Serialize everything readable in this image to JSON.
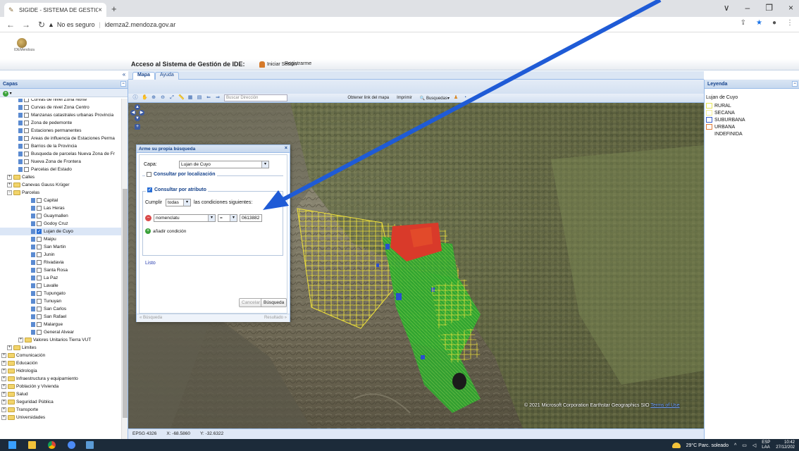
{
  "browser": {
    "tab_title": "SIGIDE - SISTEMA DE GESTION D",
    "tab_close": "×",
    "new_tab": "+",
    "security_warning": "No es seguro",
    "url": "idemza2.mendoza.gov.ar",
    "window_controls": [
      "∨",
      "–",
      "❐",
      "×"
    ]
  },
  "header": {
    "logo_text": "IDEMendoza",
    "access_title": "Acceso al Sistema de Gestión de IDE:",
    "login_label": "Iniciar Sesión",
    "register_label": "Registrarme"
  },
  "left_panel": {
    "title": "Capas",
    "collapse": "«",
    "tree": [
      {
        "label": "Curvas de nivel Zona Norte",
        "type": "layer",
        "checked": false,
        "indent": 2
      },
      {
        "label": "Curvas de nivel Zona Centro",
        "type": "layer",
        "checked": false,
        "indent": 2
      },
      {
        "label": "Manzanas catastrales urbanas Provincia",
        "type": "layer",
        "checked": false,
        "indent": 2
      },
      {
        "label": "Zona de pedemonte",
        "type": "layer",
        "checked": false,
        "indent": 2
      },
      {
        "label": "Estaciones permanentes",
        "type": "layer",
        "checked": false,
        "indent": 2
      },
      {
        "label": "Areas de influencia de Estaciones Perma",
        "type": "layer",
        "checked": false,
        "indent": 2
      },
      {
        "label": "Barrios de la Provincia",
        "type": "layer",
        "checked": false,
        "indent": 2
      },
      {
        "label": "Busqueda de parcelas Nueva Zona de Fr",
        "type": "layer",
        "checked": false,
        "indent": 2
      },
      {
        "label": "Nueva Zona de Frontera",
        "type": "layer",
        "checked": false,
        "indent": 2
      },
      {
        "label": "Parcelas del Estado",
        "type": "layer",
        "checked": false,
        "indent": 2
      },
      {
        "label": "Calles",
        "type": "folder",
        "expander": "+",
        "indent": 1
      },
      {
        "label": "Canevas Gauss Krüger",
        "type": "folder",
        "expander": "+",
        "indent": 1
      },
      {
        "label": "Parcelas",
        "type": "folder",
        "expander": "−",
        "indent": 1
      },
      {
        "label": "Capital",
        "type": "layer",
        "checked": false,
        "indent": 3
      },
      {
        "label": "Las Heras",
        "type": "layer",
        "checked": false,
        "indent": 3
      },
      {
        "label": "Guaymallen",
        "type": "layer",
        "checked": false,
        "indent": 3
      },
      {
        "label": "Godoy Cruz",
        "type": "layer",
        "checked": false,
        "indent": 3
      },
      {
        "label": "Lujan de Cuyo",
        "type": "layer",
        "checked": true,
        "indent": 3,
        "selected": true
      },
      {
        "label": "Maipu",
        "type": "layer",
        "checked": false,
        "indent": 3
      },
      {
        "label": "San Martin",
        "type": "layer",
        "checked": false,
        "indent": 3
      },
      {
        "label": "Junin",
        "type": "layer",
        "checked": false,
        "indent": 3
      },
      {
        "label": "Rivadavia",
        "type": "layer",
        "checked": false,
        "indent": 3
      },
      {
        "label": "Santa Rosa",
        "type": "layer",
        "checked": false,
        "indent": 3
      },
      {
        "label": "La Paz",
        "type": "layer",
        "checked": false,
        "indent": 3
      },
      {
        "label": "Lavalle",
        "type": "layer",
        "checked": false,
        "indent": 3
      },
      {
        "label": "Tupungato",
        "type": "layer",
        "checked": false,
        "indent": 3
      },
      {
        "label": "Tunuyan",
        "type": "layer",
        "checked": false,
        "indent": 3
      },
      {
        "label": "San Carlos",
        "type": "layer",
        "checked": false,
        "indent": 3
      },
      {
        "label": "San Rafael",
        "type": "layer",
        "checked": false,
        "indent": 3
      },
      {
        "label": "Malargue",
        "type": "layer",
        "checked": false,
        "indent": 3
      },
      {
        "label": "General Alvear",
        "type": "layer",
        "checked": false,
        "indent": 3
      },
      {
        "label": "Valores Unitarios Tierra VUT",
        "type": "folder",
        "expander": "+",
        "indent": 2
      },
      {
        "label": "Limites",
        "type": "folder",
        "expander": "+",
        "indent": 1
      },
      {
        "label": "Comunicación",
        "type": "folder",
        "expander": "+",
        "indent": 0
      },
      {
        "label": "Educación",
        "type": "folder",
        "expander": "+",
        "indent": 0
      },
      {
        "label": "Hidrología",
        "type": "folder",
        "expander": "+",
        "indent": 0
      },
      {
        "label": "Infraestructura y equipamiento",
        "type": "folder",
        "expander": "+",
        "indent": 0
      },
      {
        "label": "Población y Vivienda",
        "type": "folder",
        "expander": "+",
        "indent": 0
      },
      {
        "label": "Salud",
        "type": "folder",
        "expander": "+",
        "indent": 0
      },
      {
        "label": "Seguridad Pública",
        "type": "folder",
        "expander": "+",
        "indent": 0
      },
      {
        "label": "Transporte",
        "type": "folder",
        "expander": "+",
        "indent": 0
      },
      {
        "label": "Universidades",
        "type": "folder",
        "expander": "+",
        "indent": 0
      }
    ]
  },
  "map_tabs": [
    {
      "label": "Mapa",
      "active": true
    },
    {
      "label": "Ayuda",
      "active": false
    }
  ],
  "map_toolbar": {
    "search_placeholder": "Buscar Dirección",
    "link_label": "Obtener link del mapa",
    "print_label": "Imprimir",
    "searches_label": "Busquedas"
  },
  "status_bar": {
    "epsg": "EPSG 4326",
    "x": "X: -68.5860",
    "y": "Y: -32.6322"
  },
  "map": {
    "attribution": "© 2021 Microsoft Corporation Earthstar Geographics SIO",
    "terms": "Terms of Use"
  },
  "legend": {
    "title": "Leyenda",
    "layer": "Lujan de Cuyo",
    "items": [
      {
        "label": "RURAL",
        "color": "#e6e65a"
      },
      {
        "label": "SECANA",
        "color": "#f2ec9a"
      },
      {
        "label": "SUBURBANA",
        "color": "#3a5ecc"
      },
      {
        "label": "URBANA",
        "color": "#e07a3a"
      },
      {
        "label": "INDEFINIDA",
        "color": ""
      }
    ]
  },
  "dialog": {
    "title": "Arme su propia búsqueda",
    "close": "×",
    "layer_label": "Capa:",
    "layer_value": "Lujan de Cuyo",
    "location_legend": "Consultar por localización",
    "attr_legend": "Consultar por atributo",
    "cumplir": "Cumplir",
    "cumplir_value": "todas",
    "conditions_text": "las condiciones siguientes:",
    "field_value": "nomenclatu",
    "operator_value": "=",
    "input_value": "0613882",
    "add_condition": "añadir condición",
    "listo": "Listo",
    "cancel": "Cancelar",
    "search": "Búsqueda",
    "footer_prev": "« Búsqueda",
    "footer_next": "Resultado »"
  },
  "taskbar": {
    "weather": "29°C  Parc. soleado",
    "lang": "ESP",
    "lang2": "LAA",
    "time": "10:42",
    "date": "27/12/202"
  }
}
